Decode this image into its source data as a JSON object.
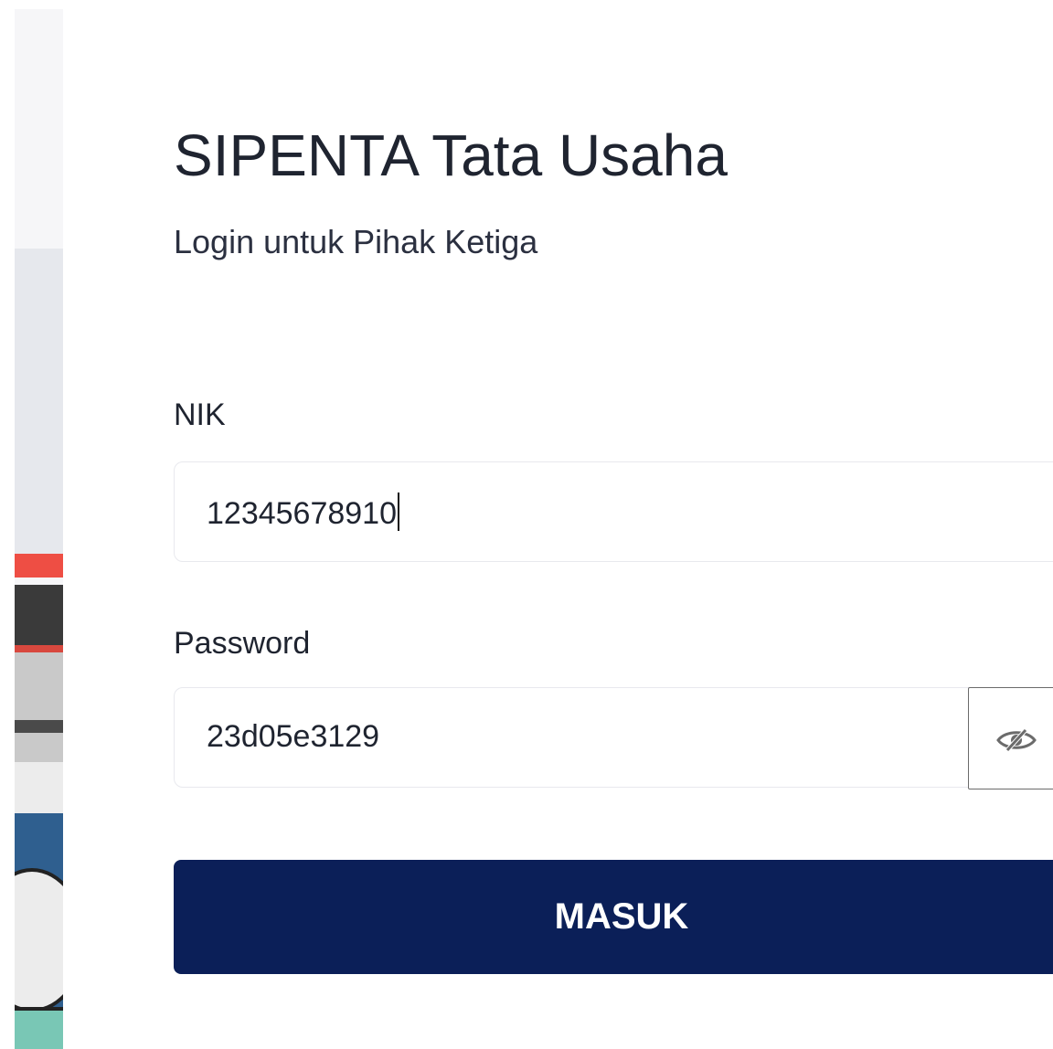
{
  "app": {
    "title": "SIPENTA Tata Usaha",
    "subtitle": "Login untuk Pihak Ketiga"
  },
  "form": {
    "nik": {
      "label": "NIK",
      "value": "12345678910"
    },
    "password": {
      "label": "Password",
      "value": "23d05e3129",
      "toggle_icon": "eye-slash-icon"
    },
    "submit_label": "MASUK"
  },
  "colors": {
    "primary": "#0b1f58",
    "text": "#1f2430",
    "border": "#e8e9ee"
  }
}
